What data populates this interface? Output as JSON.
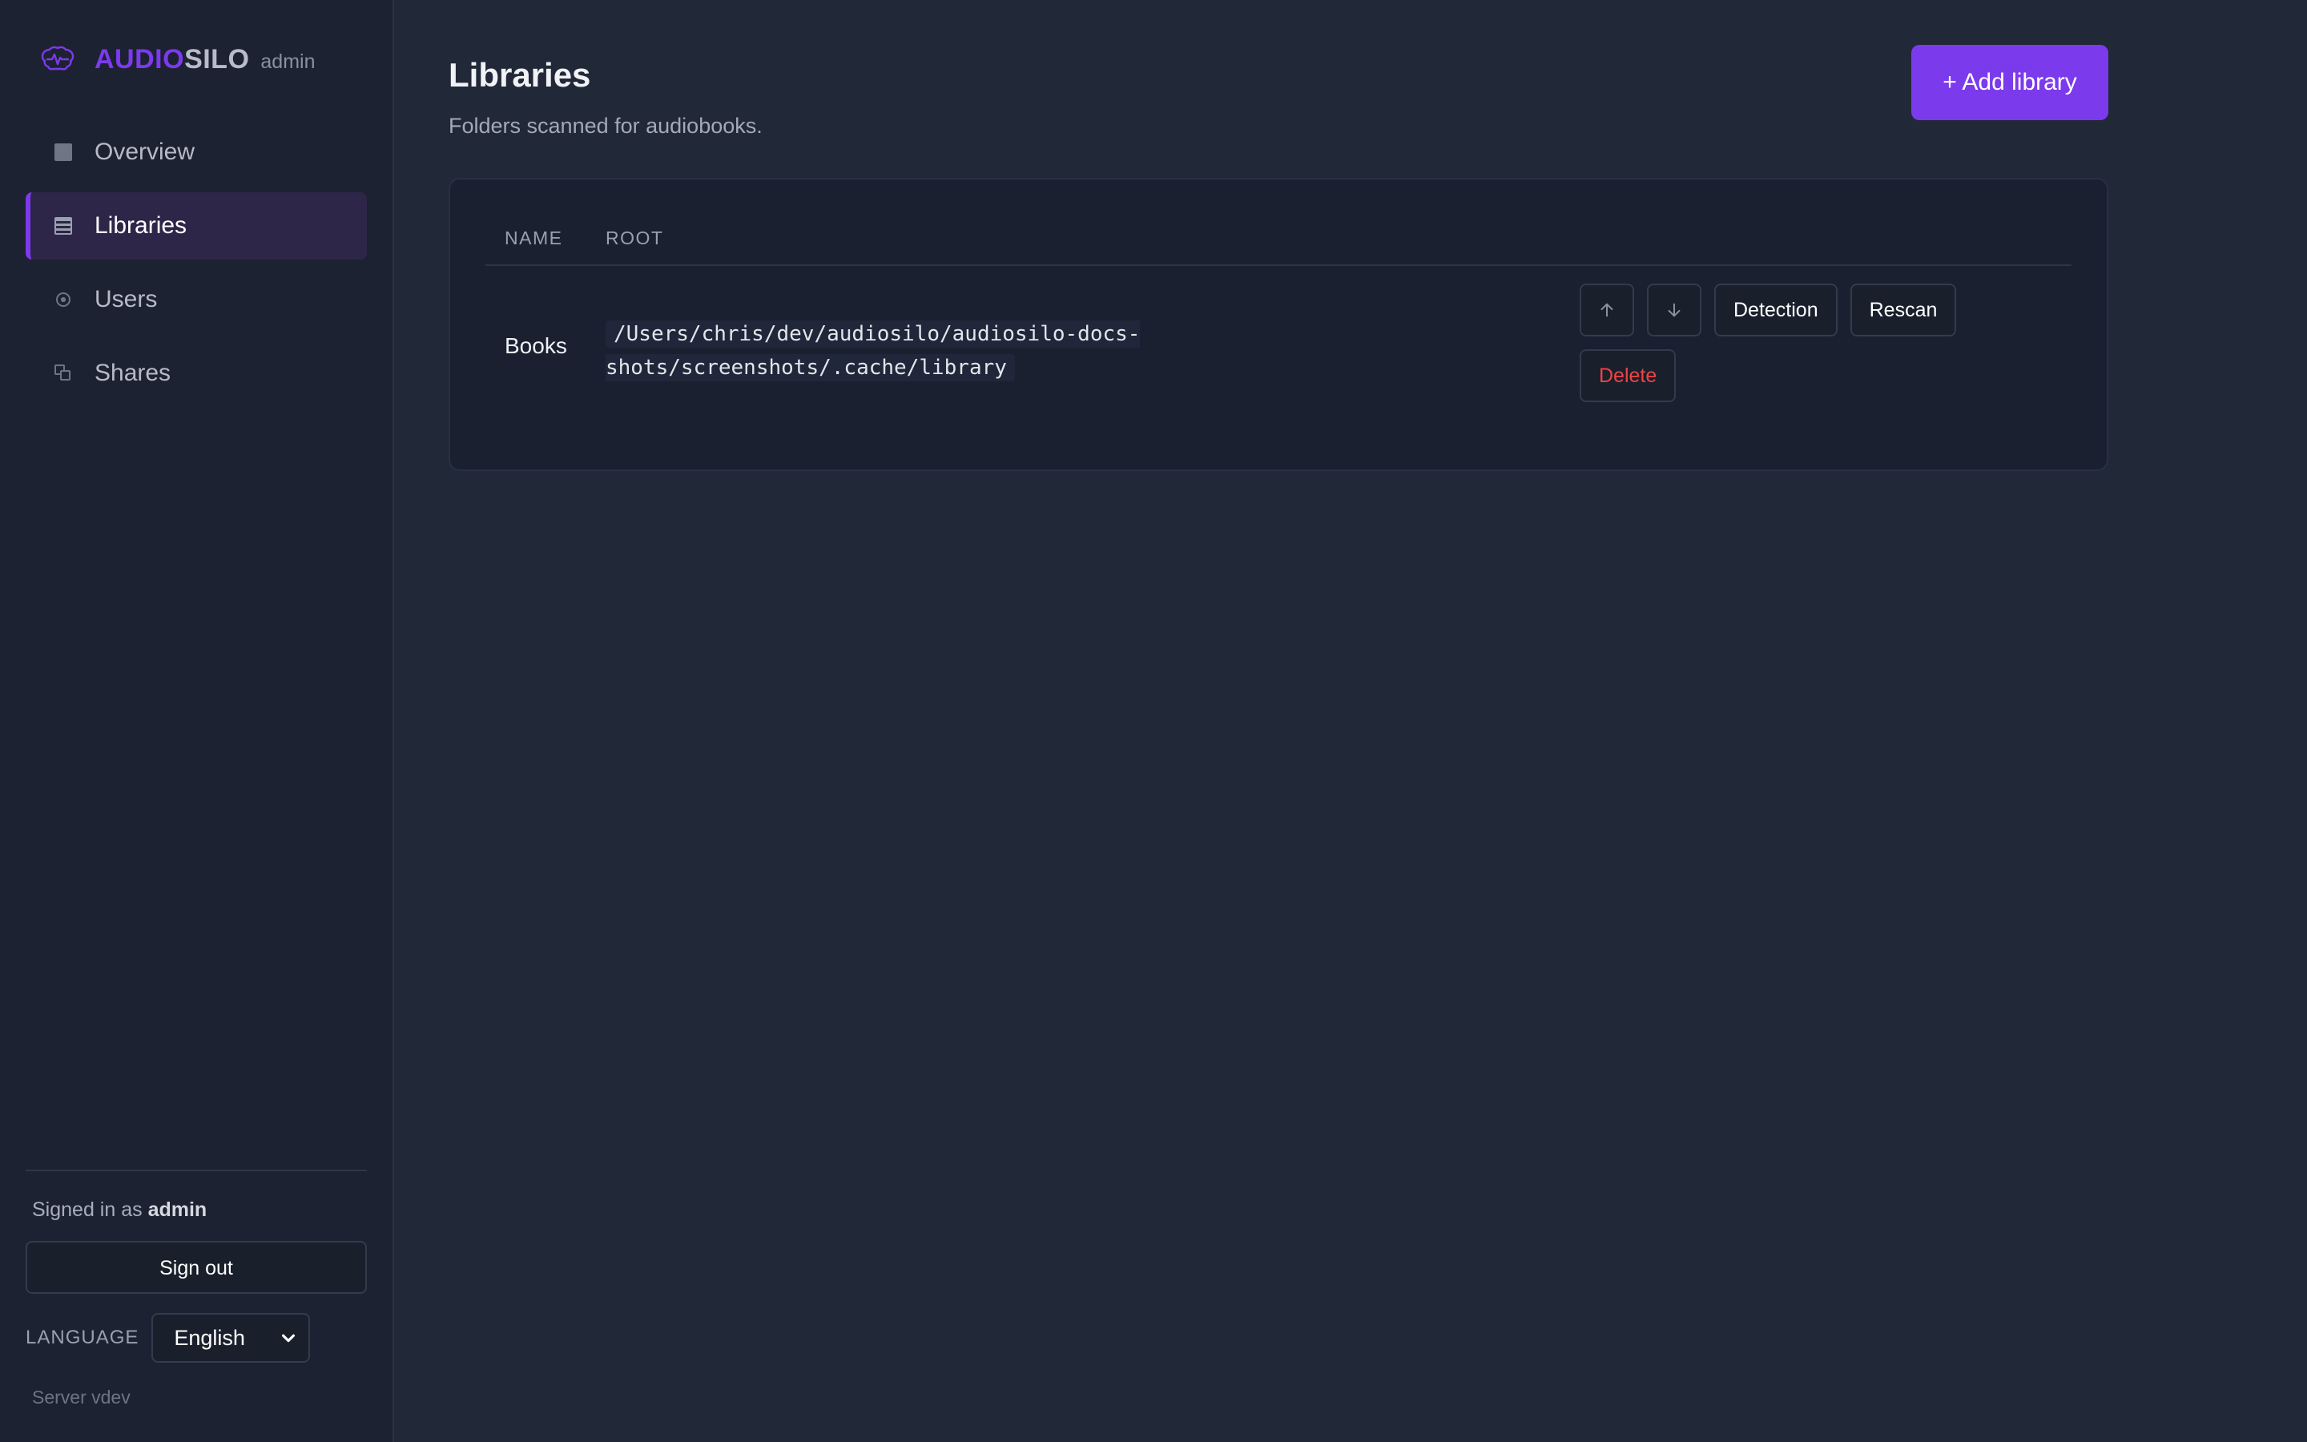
{
  "brand": {
    "name_part1": "AUDIO",
    "name_part2": "SILO",
    "subtitle": "admin",
    "logo_icon": "brain-waveform-icon",
    "accent_color": "#7c3aed"
  },
  "sidebar": {
    "items": [
      {
        "label": "Overview",
        "icon": "square-icon",
        "active": false
      },
      {
        "label": "Libraries",
        "icon": "list-icon",
        "active": true
      },
      {
        "label": "Users",
        "icon": "circle-icon",
        "active": false
      },
      {
        "label": "Shares",
        "icon": "copy-icon",
        "active": false
      }
    ],
    "signed_in_prefix": "Signed in as",
    "signed_in_user": "admin",
    "sign_out_label": "Sign out",
    "language_label": "LANGUAGE",
    "language_value": "English",
    "server_version": "Server vdev"
  },
  "page": {
    "title": "Libraries",
    "subtitle": "Folders scanned for audiobooks.",
    "add_button_label": "+ Add library"
  },
  "table": {
    "columns": [
      "NAME",
      "ROOT"
    ],
    "rows": [
      {
        "name": "Books",
        "root": "/Users/chris/dev/audiosilo/audiosilo-docs-shots/screenshots/.cache/library",
        "actions": {
          "move_up_icon": "arrow-up-icon",
          "move_down_icon": "arrow-down-icon",
          "detection_label": "Detection",
          "rescan_label": "Rescan",
          "delete_label": "Delete"
        }
      }
    ]
  }
}
